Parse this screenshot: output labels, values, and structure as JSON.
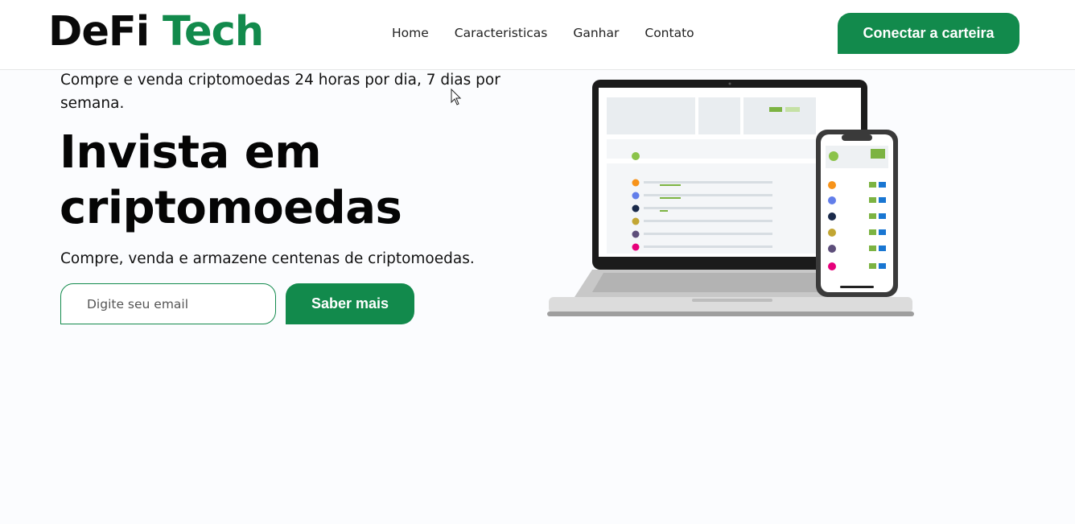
{
  "brand": {
    "part1": "DeFi",
    "part2": "Tech"
  },
  "nav": {
    "items": [
      "Home",
      "Caracteristicas",
      "Ganhar",
      "Contato"
    ]
  },
  "header": {
    "connect_label": "Conectar a carteira"
  },
  "hero": {
    "tagline": "Compre e venda criptomoedas 24 horas por dia, 7 dias por semana.",
    "headline": "Invista em criptomoedas",
    "subline": "Compre, venda e armazene centenas de criptomoedas.",
    "email_placeholder": "Digite seu email",
    "cta_label": "Saber mais"
  },
  "colors": {
    "accent": "#128a4c",
    "background": "#fbfcfe"
  },
  "icons": {
    "cursor": "arrow-cursor-icon",
    "hero_image": "laptop-phone-dashboard-illustration"
  }
}
